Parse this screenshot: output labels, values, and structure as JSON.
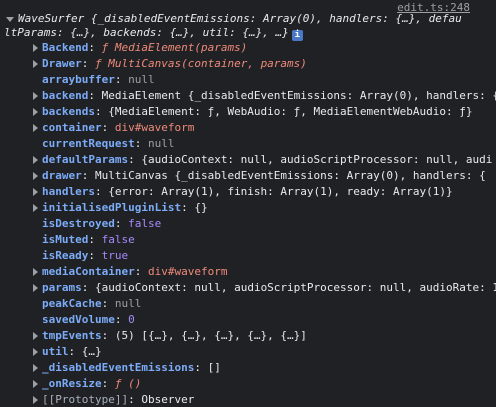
{
  "source_link": "edit.ts:248",
  "header": {
    "line1": "WaveSurfer {_disabledEventEmissions: Array(0), handlers: {…}, defau",
    "line2": "ltParams: {…}, backends: {…}, util: {…}, …}",
    "info_icon": "i"
  },
  "rows": [
    {
      "key": "Backend",
      "value": "ƒ MediaElement(params)"
    },
    {
      "key": "Drawer",
      "value": "ƒ MultiCanvas(container, params)"
    },
    {
      "key": "arraybuffer",
      "value": "null"
    },
    {
      "key": "backend",
      "value": "MediaElement {_disabledEventEmissions: Array(0), handlers: {…"
    },
    {
      "key": "backends",
      "value": "{MediaElement: ƒ, WebAudio: ƒ, MediaElementWebAudio: ƒ}"
    },
    {
      "key": "container",
      "value": "div#waveform"
    },
    {
      "key": "currentRequest",
      "value": "null"
    },
    {
      "key": "defaultParams",
      "value": "{audioContext: null, audioScriptProcessor: null, audi"
    },
    {
      "key": "drawer",
      "value": "MultiCanvas {_disabledEventEmissions: Array(0), handlers: {"
    },
    {
      "key": "handlers",
      "value": "{error: Array(1), finish: Array(1), ready: Array(1)}"
    },
    {
      "key": "initialisedPluginList",
      "value": "{}"
    },
    {
      "key": "isDestroyed",
      "value": "false"
    },
    {
      "key": "isMuted",
      "value": "false"
    },
    {
      "key": "isReady",
      "value": "true"
    },
    {
      "key": "mediaContainer",
      "value": "div#waveform"
    },
    {
      "key": "params",
      "value": "{audioContext: null, audioScriptProcessor: null, audioRate: 1"
    },
    {
      "key": "peakCache",
      "value": "null"
    },
    {
      "key": "savedVolume",
      "value": "0"
    },
    {
      "key": "tmpEvents",
      "value": "(5) [{…}, {…}, {…}, {…}, {…}]"
    },
    {
      "key": "util",
      "value": "{…}"
    },
    {
      "key": "_disabledEventEmissions",
      "value": "[]"
    },
    {
      "key": "_onResize",
      "value": "ƒ ()"
    },
    {
      "key": "[[Prototype]]",
      "value": "Observer"
    }
  ]
}
